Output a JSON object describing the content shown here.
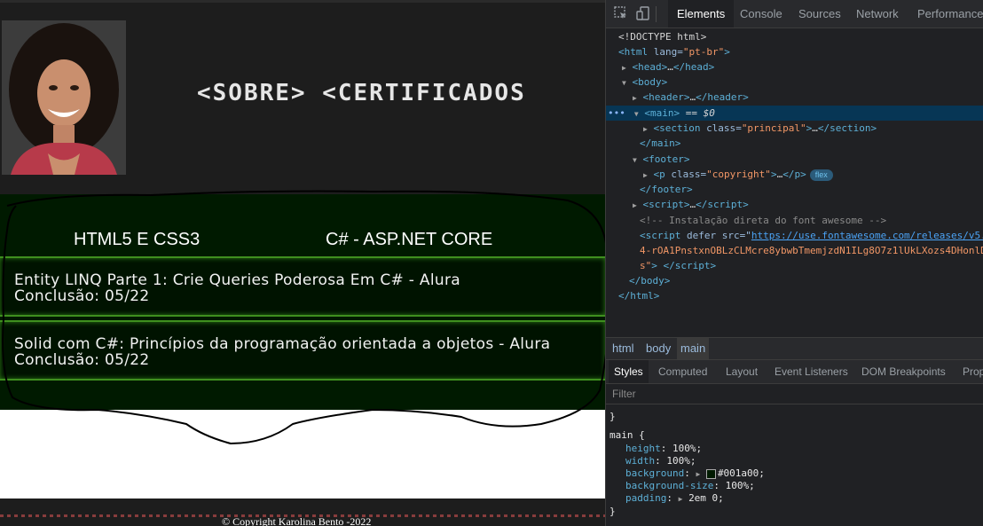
{
  "page": {
    "nav_text": "<SOBRE> <CERTIFICADOS",
    "tabs": [
      "HTML5 E CSS3",
      "C# - ASP.NET CORE"
    ],
    "cards": [
      {
        "title": "Entity LINQ Parte 1: Crie Queries Poderosa Em C# - Alura",
        "date": "Conclusão: 05/22"
      },
      {
        "title": "Solid com C#: Princípios da programação orientada a objetos - Alura",
        "date": "Conclusão: 05/22"
      }
    ],
    "copyright": "© Copyright Karolina Bento -2022",
    "colors": {
      "background": "#1d1d1d",
      "main_bg": "#001a00",
      "card_border": "#3f8f1f"
    }
  },
  "devtools": {
    "tabs": [
      "Elements",
      "Console",
      "Sources",
      "Network",
      "Performance"
    ],
    "active_tab": "Elements",
    "icons": [
      "inspect-element-icon",
      "device-toolbar-icon"
    ],
    "dom": {
      "doctype": "<!DOCTYPE html>",
      "html_tag": "html",
      "html_attr": "lang",
      "html_val": "\"pt-br\"",
      "head": "head",
      "body": "body",
      "header": "header",
      "main": "main",
      "selected_suffix": " == $0",
      "section": "section",
      "section_attr": "class",
      "section_val": "\"principal\"",
      "close_main": "/main",
      "footer": "footer",
      "p": "p",
      "p_attr": "class",
      "p_val": "\"copyright\"",
      "flex_badge": "flex",
      "close_footer": "/footer",
      "script": "script",
      "comment": "<!-- Instalação direta do font awesome -->",
      "script2_attr_defer": "defer",
      "script2_attr_src": "src",
      "script2_link": "https://use.fontawesome.com/releases/v5.",
      "script2_cont": "4-rOA1PnstxnOBLzCLMcre8ybwbTmemjzdN1ILg8O7z1lUkLXozs4DHonlD",
      "script2_end": "s\"",
      "close_script": "/script",
      "close_body": "/body",
      "close_html": "/html",
      "ellipsis": "…"
    },
    "breadcrumbs": [
      "html",
      "body",
      "main"
    ],
    "pane_tabs": [
      "Styles",
      "Computed",
      "Layout",
      "Event Listeners",
      "DOM Breakpoints",
      "Prop"
    ],
    "filter_placeholder": "Filter",
    "styles": {
      "close_brace_prev": "}",
      "selector": "main {",
      "rules": [
        {
          "prop": "height",
          "value": "100%;"
        },
        {
          "prop": "width",
          "value": "100%;"
        },
        {
          "prop": "background",
          "value": "#001a00;"
        },
        {
          "prop": "background-size",
          "value": "100%;"
        },
        {
          "prop": "padding",
          "value": "2em 0;"
        }
      ],
      "close_brace": "}"
    }
  }
}
